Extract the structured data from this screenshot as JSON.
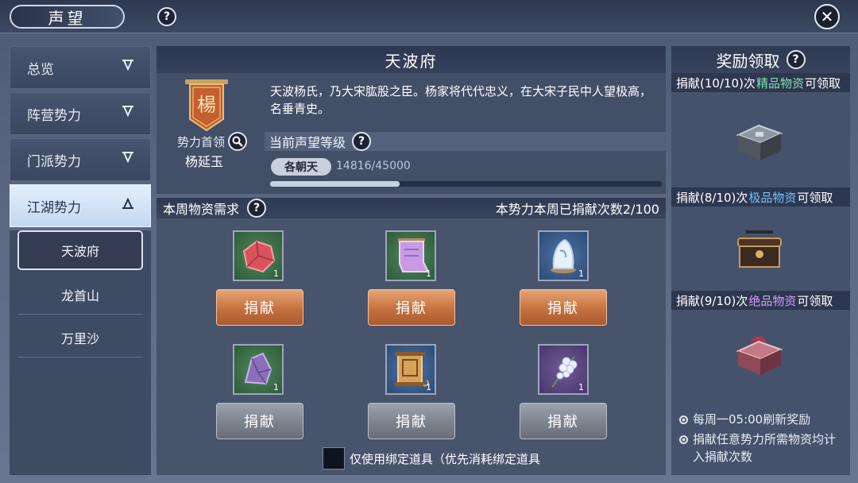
{
  "header": {
    "title": "声望",
    "help_icon": "?",
    "close_icon": "✕"
  },
  "sidebar": {
    "categories": [
      {
        "label": "总览",
        "expanded": false
      },
      {
        "label": "阵营势力",
        "expanded": false
      },
      {
        "label": "门派势力",
        "expanded": false
      },
      {
        "label": "江湖势力",
        "expanded": true
      }
    ],
    "sub_items": [
      {
        "label": "天波府",
        "selected": true
      },
      {
        "label": "龙首山",
        "selected": false
      },
      {
        "label": "万里沙",
        "selected": false
      }
    ]
  },
  "faction": {
    "name": "天波府",
    "description": "天波杨氏，乃大宋肱股之臣。杨家将代代忠义，在大宋子民中人望极高，名垂青史。",
    "banner_char": "楊",
    "leader_label": "势力首领",
    "leader_name": "杨延玉",
    "reputation_label": "当前声望等级",
    "rank": "各朝天",
    "reputation_value": "14816/45000",
    "reputation_progress": 0.33
  },
  "demand": {
    "title": "本周物资需求",
    "weekly_count": "本势力本周已捐献次数2/100",
    "donate_label": "捐献",
    "items": [
      {
        "icon": "red-ore-icon",
        "count": "1",
        "frame": "green",
        "available": true
      },
      {
        "icon": "purple-cloth-icon",
        "count": "1",
        "frame": "green",
        "available": true
      },
      {
        "icon": "jade-stone-icon",
        "count": "1",
        "frame": "blue",
        "available": true
      },
      {
        "icon": "purple-crystal-icon",
        "count": "1",
        "frame": "green",
        "available": false
      },
      {
        "icon": "scroll-icon",
        "count": "1",
        "frame": "blue",
        "available": false
      },
      {
        "icon": "flower-icon",
        "count": "1",
        "frame": "purple",
        "available": false
      }
    ],
    "bind_only_label": "仅使用绑定道具（优先消耗绑定道具"
  },
  "rewards": {
    "title": "奖励领取",
    "tiers": [
      {
        "prefix": "捐献(10/10)次",
        "tier": "精品物资",
        "suffix": "可领取",
        "color": "#7fe3a8"
      },
      {
        "prefix": "捐献(8/10)次",
        "tier": "极品物资",
        "suffix": "可领取",
        "color": "#6fc3ff"
      },
      {
        "prefix": "捐献(9/10)次",
        "tier": "绝品物资",
        "suffix": "可领取",
        "color": "#d49bff"
      }
    ],
    "notes": [
      "每周一05:00刷新奖励",
      "捐献任意势力所需物资均计入捐献次数"
    ]
  }
}
